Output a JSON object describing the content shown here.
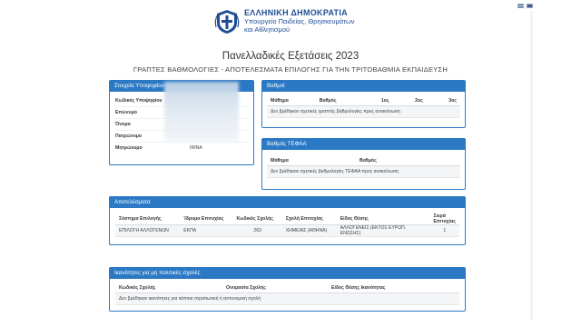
{
  "languages": [
    {
      "icon": "flag-greek-icon"
    },
    {
      "icon": "flag-english-icon"
    }
  ],
  "header": {
    "emblem_icon": "greek-coat-of-arms-icon",
    "gov_name": "ΕΛΛΗΝΙΚΗ ΔΗΜΟΚΡΑΤΙΑ",
    "ministry_line1": "Υπουργείο Παιδείας, Θρησκευμάτων",
    "ministry_line2": "και Αθλητισμού"
  },
  "page": {
    "title": "Πανελλαδικές Εξετάσεις 2023",
    "subtitle": "ΓΡΑΠΤΕΣ ΒΑΘΜΟΛΟΓΙΕΣ - ΑΠΟΤΕΛΕΣΜΑΤΑ ΕΠΙΛΟΓΗΣ ΓΙΑ ΤΗΝ ΤΡΙΤΟΒΑΘΜΙΑ ΕΚΠΑΙΔΕΥΣΗ"
  },
  "candidate": {
    "heading": "Στοιχεία Υποψηφίου",
    "rows": [
      {
        "label": "Κωδικός Υποψηφίου",
        "value": ""
      },
      {
        "label": "Επώνυμο",
        "value": ""
      },
      {
        "label": "Όνομα",
        "value": ""
      },
      {
        "label": "Πατρώνυμο",
        "value": ""
      },
      {
        "label": "Μητρώνυμο",
        "value": "IRINA"
      }
    ]
  },
  "grades": {
    "heading": "Βαθμοί",
    "columns": [
      "Μάθημα",
      "Βαθμός",
      "1ος",
      "2ος",
      "3ος"
    ],
    "empty_message": "Δεν βρέθηκαν σχετικές γραπτές βαθμολογίες προς ανακοίνωση"
  },
  "tefaa": {
    "heading": "Βαθμός ΤΕΦΑΑ",
    "columns": [
      "Μάθημα",
      "Βαθμός"
    ],
    "empty_message": "Δεν βρέθηκαν σχετικές βαθμολογίες ΤΕΦΑΑ προς ανακοίνωση"
  },
  "results": {
    "heading": "Αποτελέσματα",
    "columns": [
      "Σύστημα Επιλογής",
      "Ίδρυμα Επιτυχίας",
      "Κωδικός Σχολής",
      "Σχολή Επιτυχίας",
      "Είδος Θέσης",
      "Σειρά Επιτυχίας"
    ],
    "rows": [
      [
        "ΕΠΙΛΟΓΗ ΑΛΛΟΓΕΝΩΝ",
        "ΕΚΠΑ",
        "263",
        "ΧΗΜΕΙΑΣ (ΑΘΗΝΑ)",
        "ΑΛΛΟΓΕΝΕΙΣ (ΕΚΤΟΣ ΕΥΡΩΠ. ΕΝΩΣΗΣ)",
        "1"
      ]
    ]
  },
  "eligibility": {
    "heading": "Ικανότητες για μη πολιτικές σχολές",
    "columns": [
      "Κωδικός Σχολής",
      "Ονομασία Σχολής",
      "Είδος Θέσης Ικανότητας"
    ],
    "empty_message": "Δεν βρέθηκαν ικανότητες για κάποια στρατιωτική ή αστυνομική σχολή"
  },
  "colors": {
    "accent": "#2b79c4",
    "header_text": "#1f4e96"
  }
}
